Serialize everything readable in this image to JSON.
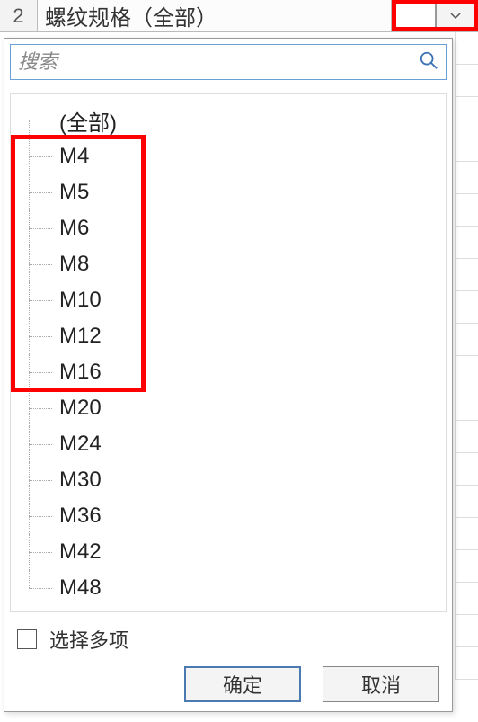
{
  "header": {
    "row_number": "2",
    "label": "螺纹规格（全部）"
  },
  "search": {
    "placeholder": "搜索"
  },
  "tree": {
    "root_label": "(全部)",
    "items": [
      {
        "label": "M4"
      },
      {
        "label": "M5"
      },
      {
        "label": "M6"
      },
      {
        "label": "M8"
      },
      {
        "label": "M10"
      },
      {
        "label": "M12"
      },
      {
        "label": "M16"
      },
      {
        "label": "M20"
      },
      {
        "label": "M24"
      },
      {
        "label": "M30"
      },
      {
        "label": "M36"
      },
      {
        "label": "M42"
      },
      {
        "label": "M48"
      }
    ],
    "highlighted_range": {
      "start": 0,
      "end": 6
    }
  },
  "footer": {
    "multiselect_label": "选择多项",
    "ok_label": "确定",
    "cancel_label": "取消"
  },
  "colors": {
    "highlight": "#ff0000",
    "accent_blue": "#4a7ab0"
  }
}
